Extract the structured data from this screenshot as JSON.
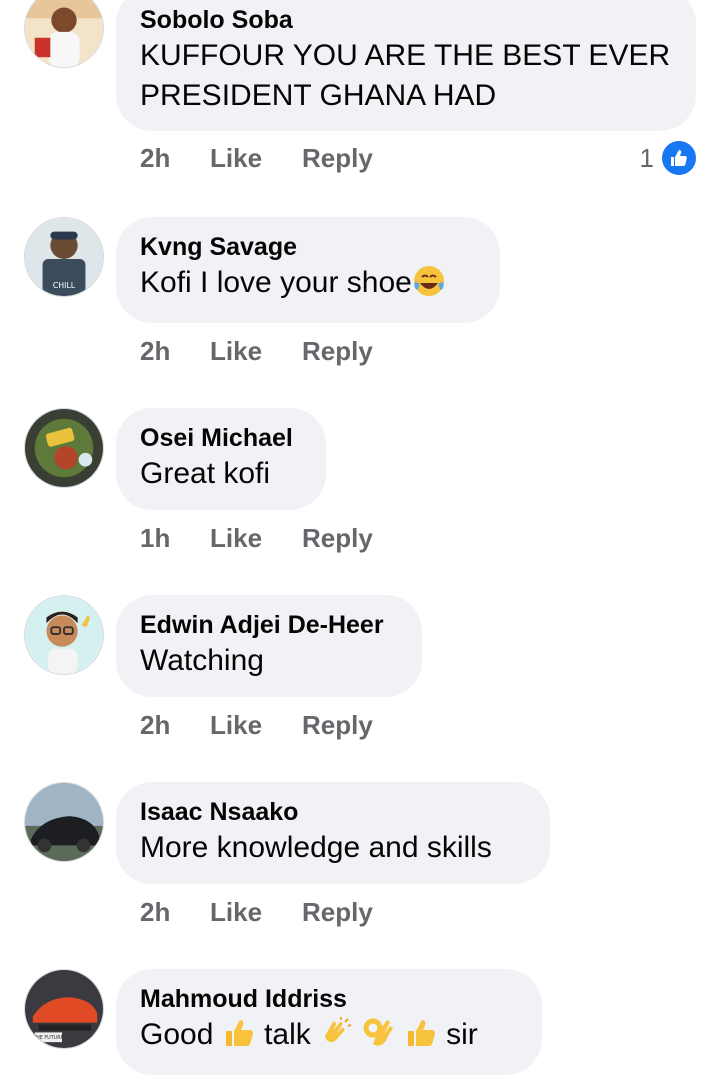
{
  "comments": [
    {
      "author": "Sobolo Soba",
      "text_line1": "KUFFOUR YOU ARE THE BEST EVER",
      "text_line2": "PRESIDENT GHANA HAD",
      "time": "2h",
      "like_label": "Like",
      "reply_label": "Reply",
      "reaction_count": "1",
      "reaction_icon": "thumbs-up-icon"
    },
    {
      "author": "Kvng Savage",
      "text": "Kofi I love your shoe",
      "emoji": "tears-of-joy-emoji",
      "time": "2h",
      "like_label": "Like",
      "reply_label": "Reply"
    },
    {
      "author": "Osei Michael",
      "text": "Great kofi",
      "time": "1h",
      "like_label": "Like",
      "reply_label": "Reply"
    },
    {
      "author": "Edwin Adjei De-Heer",
      "text": "Watching",
      "time": "2h",
      "like_label": "Like",
      "reply_label": "Reply"
    },
    {
      "author": "Isaac Nsaako",
      "text": "More knowledge and skills",
      "time": "2h",
      "like_label": "Like",
      "reply_label": "Reply"
    },
    {
      "author": "Mahmoud Iddriss",
      "text_parts": [
        "Good",
        "talk",
        "sir"
      ],
      "emojis": [
        "thumbs-up-emoji",
        "clapping-hands-emoji",
        "ok-hand-emoji",
        "thumbs-up-emoji"
      ]
    }
  ],
  "colors": {
    "bubble": "#f0f2f5",
    "meta_text": "#65676b",
    "like_blue": "#1877f2"
  }
}
